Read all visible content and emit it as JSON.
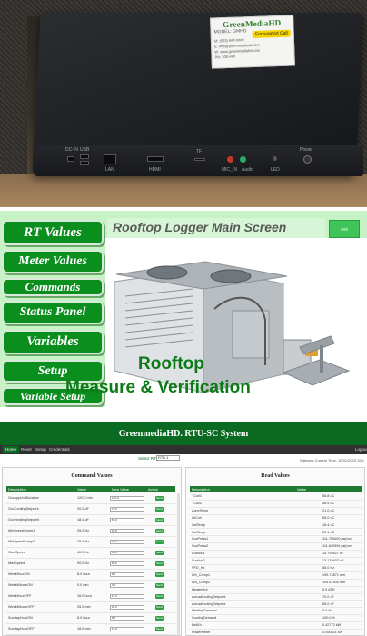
{
  "photo": {
    "sticker": {
      "title": "GreenMediaHD",
      "model": "MODEL: GMHD",
      "support": "For support Call",
      "lines": [
        "M: (503) ###-####",
        "E: info@greenmediahd.com",
        "W: www.greenmediahd.com",
        "PN: 200-###"
      ]
    },
    "port_labels": [
      "DC-IN",
      "USB",
      "LAN",
      "HDMI",
      "TF",
      "MIC_IN",
      "Audio",
      "LED",
      "Power"
    ]
  },
  "main_screen": {
    "title": "Rooftop Logger Main Screen",
    "exit_label": "exit",
    "nav": [
      {
        "label": "RT Values"
      },
      {
        "label": "Meter Values"
      },
      {
        "label": "Commands"
      },
      {
        "label": "Status Panel"
      },
      {
        "label": "Variables"
      },
      {
        "label": "Setup"
      },
      {
        "label": "Variable Setup"
      }
    ],
    "tagline_1": "Rooftop",
    "tagline_2": "Measure & Verification"
  },
  "web": {
    "title": "GreenmediaHD. RTU-SC System",
    "nav": [
      "Home",
      "Reset",
      "Setup",
      "Credentials"
    ],
    "logout": "Logout",
    "select_label": "Select RTU",
    "select_value": "RTU-1",
    "gateway": "Gateway Current Time: 10/01/2023 15:1",
    "command": {
      "title": "Command Values",
      "headers": [
        "Description",
        "Value",
        "New Value",
        "Action"
      ],
      "action_label": "Send",
      "rows": [
        {
          "d": "OccupyUnitDuration",
          "v": "120.0 min",
          "n": "120.0"
        },
        {
          "d": "OccCoolingSetpoint",
          "v": "20.0 oF",
          "n": "75.0"
        },
        {
          "d": "OccHeatingSetpoint",
          "v": "18.0 oF",
          "n": "65.0"
        },
        {
          "d": "MinSpeedComp1",
          "v": "25.0 Hz",
          "n": "25.0"
        },
        {
          "d": "MinSpeedComp2",
          "v": "25.0 Hz",
          "n": "25.0"
        },
        {
          "d": "StartSpeed",
          "v": "40.0 Hz",
          "n": "40.0"
        },
        {
          "d": "MaxSpeed",
          "v": "90.0 Hz",
          "n": "90.0"
        },
        {
          "d": "WeekHourON",
          "v": "8.0 hour",
          "n": "8.0"
        },
        {
          "d": "WeekMinuteON",
          "v": "0.0 min",
          "n": "0.0"
        },
        {
          "d": "WeekHourOFF",
          "v": "16.0 hour",
          "n": "16.0"
        },
        {
          "d": "WeekMinuteOFF",
          "v": "25.0 min",
          "n": "25.0"
        },
        {
          "d": "SundayHourON",
          "v": "8.0 hour",
          "n": "8.0"
        },
        {
          "d": "SundayHourOFF",
          "v": "16.0 min",
          "n": "16.0"
        }
      ]
    },
    "read": {
      "title": "Read Values",
      "headers": [
        "Description",
        "Value"
      ],
      "rows": [
        {
          "d": "TCoil1",
          "v": "56.8 oC"
        },
        {
          "d": "TCoil2",
          "v": "56.5 oC"
        },
        {
          "d": "ZoneTemp",
          "v": "21.0 oC"
        },
        {
          "d": "InlCoil",
          "v": "55.0 oC"
        },
        {
          "d": "SatTemp",
          "v": "16.4 oC"
        },
        {
          "d": "OutTemp",
          "v": "20.1 oC"
        },
        {
          "d": "SucPress1",
          "v": "111.700000 psi(mv)"
        },
        {
          "d": "SucPress2",
          "v": "111.640994 psi(mv)"
        },
        {
          "d": "Suction1",
          "v": "14.793927 oF"
        },
        {
          "d": "Suction2",
          "v": "13.176602 oF"
        },
        {
          "d": "VFD_Hz",
          "v": "55.0 Hz"
        },
        {
          "d": "Wh_Comp1",
          "v": "195.74871 mm"
        },
        {
          "d": "Wh_Comp2",
          "v": "194.87830 mm"
        },
        {
          "d": "HeaterOut",
          "v": "0.0 ATH"
        },
        {
          "d": "ActualCoolingSetpoint",
          "v": "70.0 oF"
        },
        {
          "d": "ActualCoolingSetpoint",
          "v": "65.0 oF"
        },
        {
          "d": "HeatingDemand",
          "v": "0.0 %"
        },
        {
          "d": "CoolingDemand",
          "v": "100.0 %"
        },
        {
          "d": "Belt1h",
          "v": "0.42772 kW"
        },
        {
          "d": "PowerMeter",
          "v": "0.000821 kW"
        }
      ]
    }
  },
  "colors": {
    "nav_green": "#0a8f1e",
    "screen_bg": "#c6f2c6",
    "web_header": "#0a6a22",
    "send_green": "#2ea043"
  }
}
